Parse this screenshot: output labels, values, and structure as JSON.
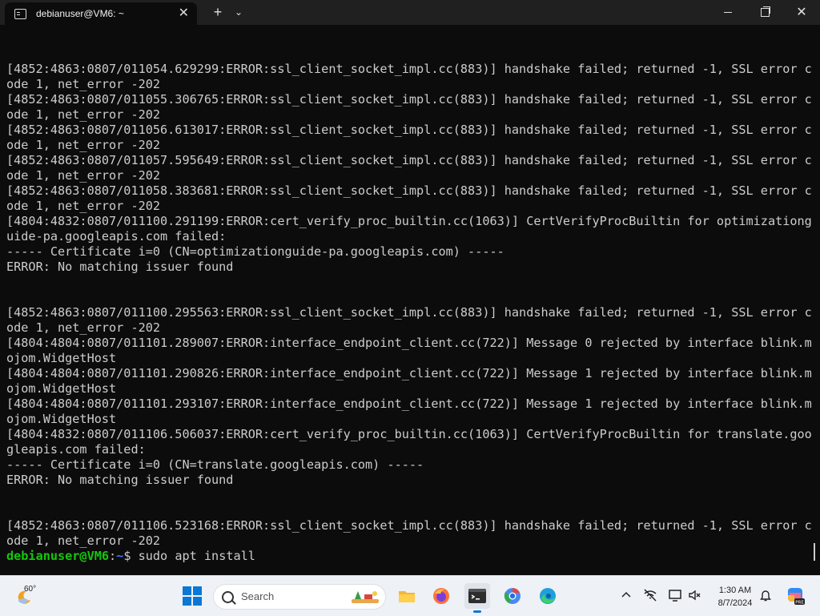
{
  "window": {
    "tab_title": "debianuser@VM6: ~",
    "tab_close": "✕",
    "new_tab": "+",
    "dropdown": "⌄",
    "close": "✕"
  },
  "terminal": {
    "lines": [
      "[4852:4863:0807/011054.629299:ERROR:ssl_client_socket_impl.cc(883)] handshake failed; returned -1, SSL error c",
      "ode 1, net_error -202",
      "[4852:4863:0807/011055.306765:ERROR:ssl_client_socket_impl.cc(883)] handshake failed; returned -1, SSL error c",
      "ode 1, net_error -202",
      "[4852:4863:0807/011056.613017:ERROR:ssl_client_socket_impl.cc(883)] handshake failed; returned -1, SSL error c",
      "ode 1, net_error -202",
      "[4852:4863:0807/011057.595649:ERROR:ssl_client_socket_impl.cc(883)] handshake failed; returned -1, SSL error c",
      "ode 1, net_error -202",
      "[4852:4863:0807/011058.383681:ERROR:ssl_client_socket_impl.cc(883)] handshake failed; returned -1, SSL error c",
      "ode 1, net_error -202",
      "[4804:4832:0807/011100.291199:ERROR:cert_verify_proc_builtin.cc(1063)] CertVerifyProcBuiltin for optimizationg",
      "uide-pa.googleapis.com failed:",
      "----- Certificate i=0 (CN=optimizationguide-pa.googleapis.com) -----",
      "ERROR: No matching issuer found",
      "",
      "",
      "[4852:4863:0807/011100.295563:ERROR:ssl_client_socket_impl.cc(883)] handshake failed; returned -1, SSL error c",
      "ode 1, net_error -202",
      "[4804:4804:0807/011101.289007:ERROR:interface_endpoint_client.cc(722)] Message 0 rejected by interface blink.m",
      "ojom.WidgetHost",
      "[4804:4804:0807/011101.290826:ERROR:interface_endpoint_client.cc(722)] Message 1 rejected by interface blink.m",
      "ojom.WidgetHost",
      "[4804:4804:0807/011101.293107:ERROR:interface_endpoint_client.cc(722)] Message 1 rejected by interface blink.m",
      "ojom.WidgetHost",
      "[4804:4832:0807/011106.506037:ERROR:cert_verify_proc_builtin.cc(1063)] CertVerifyProcBuiltin for translate.goo",
      "gleapis.com failed:",
      "----- Certificate i=0 (CN=translate.googleapis.com) -----",
      "ERROR: No matching issuer found",
      "",
      "",
      "[4852:4863:0807/011106.523168:ERROR:ssl_client_socket_impl.cc(883)] handshake failed; returned -1, SSL error c",
      "ode 1, net_error -202"
    ],
    "prompt": {
      "user_host": "debianuser@VM6",
      "separator": ":",
      "path": "~",
      "symbol": "$ ",
      "command": "sudo apt install"
    },
    "colors": {
      "background": "#0c0c0c",
      "text": "#cccccc",
      "prompt_user": "#16c60c",
      "prompt_path": "#3b78ff"
    }
  },
  "taskbar": {
    "weather_temp": "60°",
    "search_placeholder": "Search",
    "apps": [
      {
        "name": "File Explorer",
        "icon": "folder-icon"
      },
      {
        "name": "Firefox",
        "icon": "firefox-icon"
      },
      {
        "name": "Terminal",
        "icon": "terminal-icon",
        "active": true
      },
      {
        "name": "Chrome",
        "icon": "chrome-icon"
      },
      {
        "name": "Edge",
        "icon": "edge-icon"
      }
    ],
    "clock_time": "1:30 AM",
    "clock_date": "8/7/2024",
    "accent": "#0a78d4"
  }
}
